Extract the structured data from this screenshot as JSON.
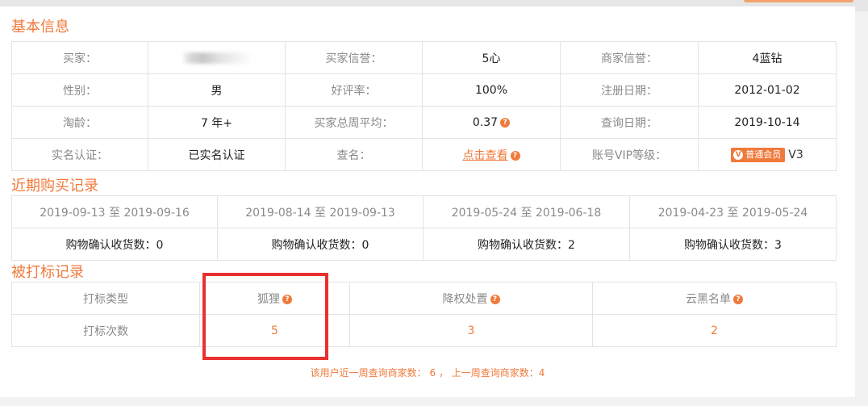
{
  "colors": {
    "accent": "#f07a3c",
    "highlight": "#e8312f"
  },
  "basic_info": {
    "title": "基本信息",
    "rows": [
      [
        {
          "label": "买家：",
          "value": ""
        },
        {
          "label": "买家信誉：",
          "value": "5心"
        },
        {
          "label": "商家信誉：",
          "value": "4蓝钻"
        }
      ],
      [
        {
          "label": "性别：",
          "value": "男"
        },
        {
          "label": "好评率：",
          "value": "100%"
        },
        {
          "label": "注册日期：",
          "value": "2012-01-02"
        }
      ],
      [
        {
          "label": "淘龄：",
          "value": "7 年+"
        },
        {
          "label": "买家总周平均：",
          "value": "0.37"
        },
        {
          "label": "查询日期：",
          "value": "2019-10-14"
        }
      ],
      [
        {
          "label": "实名认证：",
          "value": "已实名认证"
        },
        {
          "label": "查名：",
          "value": "点击查看"
        },
        {
          "label": "账号VIP等级：",
          "value": "V3"
        }
      ]
    ],
    "vip_badge": "普通会员",
    "help_icon": "question-icon"
  },
  "recent_purchases": {
    "title": "近期购买记录",
    "ranges": [
      "2019-09-13 至 2019-09-16",
      "2019-08-14 至 2019-09-13",
      "2019-05-24 至 2019-06-18",
      "2019-04-23 至 2019-05-24"
    ],
    "counts": [
      "购物确认收货数：0",
      "购物确认收货数：0",
      "购物确认收货数：2",
      "购物确认收货数：3"
    ]
  },
  "marked_records": {
    "title": "被打标记录",
    "row_headers": [
      "打标类型",
      "打标次数"
    ],
    "types": [
      "狐狸",
      "降权处置",
      "云黑名单"
    ],
    "counts": [
      "5",
      "3",
      "2"
    ]
  },
  "footer": {
    "note": "该用户近一周查询商家数：  6 ，   上一周查询商家数：4"
  }
}
